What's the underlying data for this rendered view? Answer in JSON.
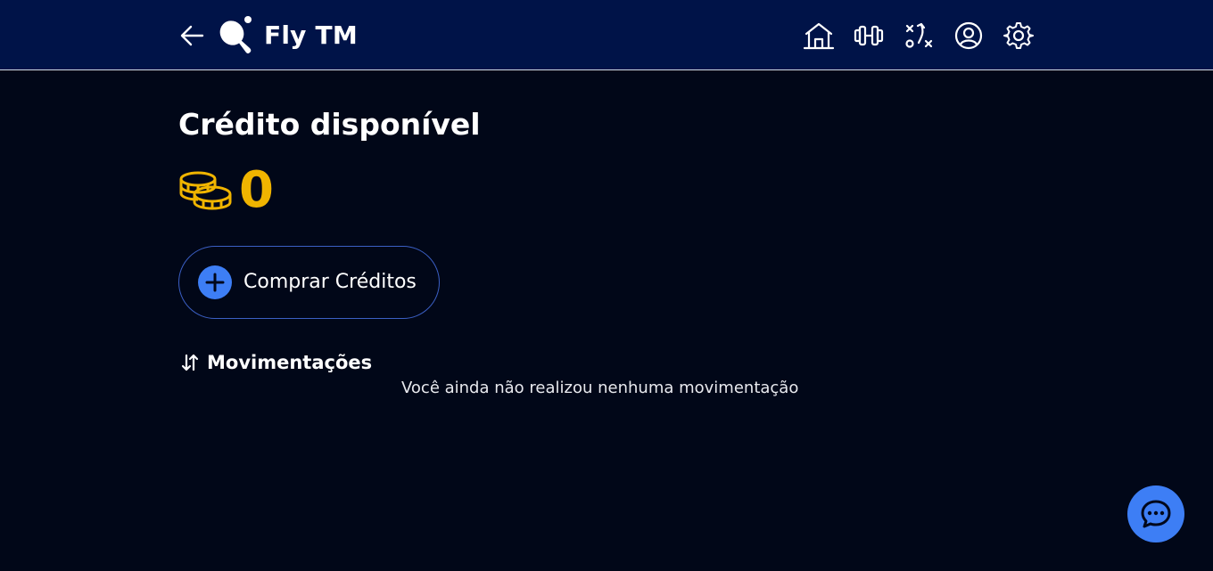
{
  "header": {
    "app_title": "Fly TM",
    "back_icon": "arrow-left-icon",
    "logo_icon": "table-tennis-paddle-icon",
    "nav_icons": [
      "home-icon",
      "dumbbell-icon",
      "tactics-icon",
      "user-circle-icon",
      "gear-icon"
    ]
  },
  "credits": {
    "title": "Crédito disponível",
    "value": "0",
    "coins_icon": "coins-icon",
    "value_color": "#f0b400"
  },
  "buy_button": {
    "label": "Comprar Créditos",
    "icon": "plus-icon"
  },
  "movements": {
    "title": "Movimentações",
    "icon": "sort-arrows-icon",
    "empty_message": "Você ainda não realizou nenhuma movimentação"
  },
  "chat": {
    "icon": "chat-bubble-icon"
  },
  "colors": {
    "header_bg": "#001348",
    "page_bg": "#010718",
    "accent": "#3d7ef5",
    "gold": "#f0b400"
  }
}
